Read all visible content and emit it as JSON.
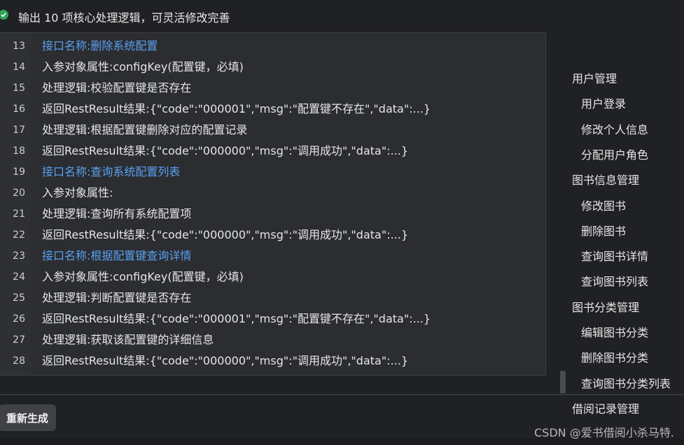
{
  "header": {
    "status_text": "输出 10 项核心处理逻辑，可灵活修改完善"
  },
  "code": {
    "lines": [
      {
        "num": "13",
        "text": "接口名称:删除系统配置",
        "link": true
      },
      {
        "num": "14",
        "text": "入参对象属性:configKey(配置键，必填)",
        "link": false
      },
      {
        "num": "15",
        "text": "处理逻辑:校验配置键是否存在",
        "link": false
      },
      {
        "num": "16",
        "text": "返回RestResult结果:{\"code\":\"000001\",\"msg\":\"配置键不存在\",\"data\":...}",
        "link": false
      },
      {
        "num": "17",
        "text": "处理逻辑:根据配置键删除对应的配置记录",
        "link": false
      },
      {
        "num": "18",
        "text": "返回RestResult结果:{\"code\":\"000000\",\"msg\":\"调用成功\",\"data\":...}",
        "link": false
      },
      {
        "num": "19",
        "text": "接口名称:查询系统配置列表",
        "link": true
      },
      {
        "num": "20",
        "text": "入参对象属性:",
        "link": false
      },
      {
        "num": "21",
        "text": "处理逻辑:查询所有系统配置项",
        "link": false
      },
      {
        "num": "22",
        "text": "返回RestResult结果:{\"code\":\"000000\",\"msg\":\"调用成功\",\"data\":...}",
        "link": false
      },
      {
        "num": "23",
        "text": "接口名称:根据配置键查询详情",
        "link": true
      },
      {
        "num": "24",
        "text": "入参对象属性:configKey(配置键，必填)",
        "link": false
      },
      {
        "num": "25",
        "text": "处理逻辑:判断配置键是否存在",
        "link": false
      },
      {
        "num": "26",
        "text": "返回RestResult结果:{\"code\":\"000001\",\"msg\":\"配置键不存在\",\"data\":...}",
        "link": false
      },
      {
        "num": "27",
        "text": "处理逻辑:获取该配置键的详细信息",
        "link": false
      },
      {
        "num": "28",
        "text": "返回RestResult结果:{\"code\":\"000000\",\"msg\":\"调用成功\",\"data\":...}",
        "link": false
      }
    ]
  },
  "actions": {
    "regenerate_label": "重新生成"
  },
  "outline": {
    "items": [
      {
        "label": "用户管理",
        "level": 1
      },
      {
        "label": "用户登录",
        "level": 2
      },
      {
        "label": "修改个人信息",
        "level": 2
      },
      {
        "label": "分配用户角色",
        "level": 2
      },
      {
        "label": "图书信息管理",
        "level": 1
      },
      {
        "label": "修改图书",
        "level": 2
      },
      {
        "label": "删除图书",
        "level": 2
      },
      {
        "label": "查询图书详情",
        "level": 2
      },
      {
        "label": "查询图书列表",
        "level": 2
      },
      {
        "label": "图书分类管理",
        "level": 1
      },
      {
        "label": "编辑图书分类",
        "level": 2
      },
      {
        "label": "删除图书分类",
        "level": 2
      },
      {
        "label": "查询图书分类列表",
        "level": 2
      },
      {
        "label": "借阅记录管理",
        "level": 1
      }
    ]
  },
  "watermark": "CSDN @爱书借阅小杀马特.",
  "colors": {
    "link": "#5aa0f0",
    "success": "#2fa35a",
    "background": "#202124",
    "panel": "#2b2d31"
  }
}
